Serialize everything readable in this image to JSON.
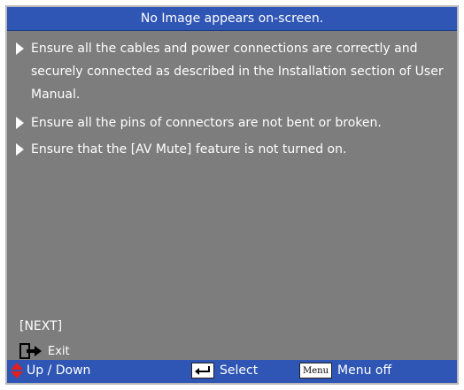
{
  "title": "No Image appears on-screen.",
  "items": [
    "Ensure all the cables and power connections are correctly and securely connected as described in the Installation section of User Manual.",
    "Ensure all the pins of connectors are not bent or broken.",
    "Ensure that the [AV Mute] feature is not turned on."
  ],
  "next_label": "[NEXT]",
  "exit_label": "Exit",
  "footer": {
    "updown_label": "Up / Down",
    "select_label": "Select",
    "menu_key_label": "Menu",
    "menuoff_label": "Menu off"
  },
  "colors": {
    "panel_bg": "#7d7d7d",
    "bar_bg": "#2f55b5",
    "updown_icon": "#e02020"
  },
  "icons": {
    "bullet": "triangle-right-icon",
    "exit": "exit-door-icon",
    "updown": "updown-arrows-icon",
    "select": "enter-key-icon",
    "menu": "menu-key-icon"
  }
}
